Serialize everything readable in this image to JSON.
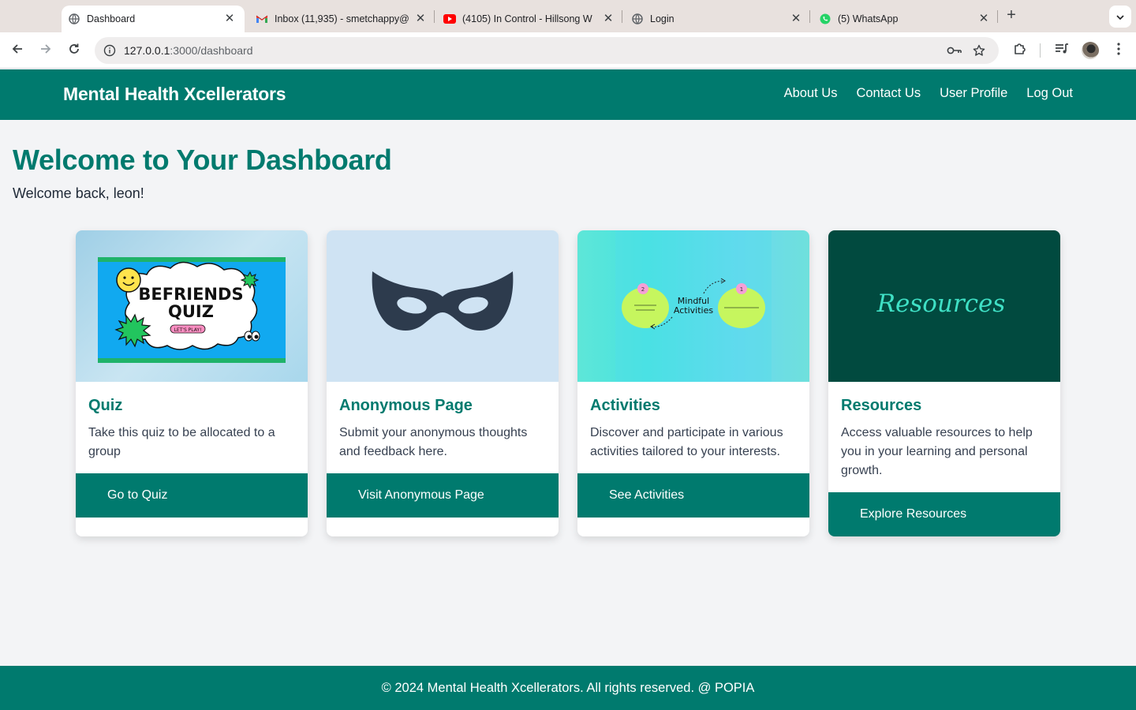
{
  "browser": {
    "tabs": [
      {
        "title": "Dashboard",
        "icon": "globe-icon",
        "active": true
      },
      {
        "title": "Inbox (11,935) - smetchappy@",
        "icon": "gmail-icon"
      },
      {
        "title": "(4105) In Control - Hillsong W",
        "icon": "youtube-icon"
      },
      {
        "title": "Login",
        "icon": "globe-icon"
      },
      {
        "title": "(5) WhatsApp",
        "icon": "whatsapp-icon"
      }
    ],
    "new_tab": "+",
    "url_host": "127.0.0.1",
    "url_path": ":3000/dashboard"
  },
  "header": {
    "brand": "Mental Health Xcellerators",
    "nav": [
      "About Us",
      "Contact Us",
      "User Profile",
      "Log Out"
    ]
  },
  "main": {
    "title": "Welcome to Your Dashboard",
    "welcome": "Welcome back, leon!"
  },
  "cards": [
    {
      "title": "Quiz",
      "description": "Take this quiz to be allocated to a group",
      "button": "Go to Quiz",
      "image": {
        "line1": "BEFRIENDS",
        "line2": "QUIZ",
        "tag": "LET'S PLAY!"
      }
    },
    {
      "title": "Anonymous Page",
      "description": "Submit your anonymous thoughts and feedback here.",
      "button": "Visit Anonymous Page",
      "image": {
        "icon": "mask-icon"
      }
    },
    {
      "title": "Activities",
      "description": "Discover and participate in various activities tailored to your interests.",
      "button": "See Activities",
      "image": {
        "line1": "Mindful",
        "line2": "Activities",
        "badge_left": "2",
        "badge_right": "1"
      }
    },
    {
      "title": "Resources",
      "description": "Access valuable resources to help you in your learning and personal growth.",
      "button": "Explore Resources",
      "image": {
        "text": "Resources"
      }
    }
  ],
  "footer": {
    "text": "© 2024 Mental Health Xcellerators. All rights reserved. @ POPIA"
  },
  "colors": {
    "primary": "#007a6e",
    "background": "#f3f4f6",
    "resources_bg": "#014a3f"
  }
}
